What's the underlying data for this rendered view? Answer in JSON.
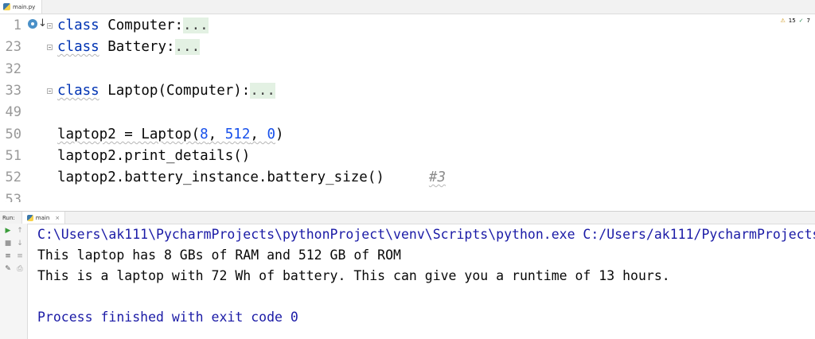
{
  "editor_tab": {
    "file_name": "main.py"
  },
  "inspections": {
    "warnings": "15",
    "checks": "7"
  },
  "gutter": {
    "line_numbers": [
      "1",
      "23",
      "32",
      "33",
      "49",
      "50",
      "51",
      "52",
      "53"
    ]
  },
  "code": {
    "lines": [
      {
        "kw": "class",
        "rest": " Computer:",
        "fold": "..."
      },
      {
        "kw": "class",
        "rest": " Battery:",
        "fold": "..."
      },
      {
        "kw": "class",
        "rest": " Laptop(Computer):",
        "fold": "..."
      }
    ],
    "call_line": {
      "prefix": "laptop2 = Laptop(",
      "arg1": "8",
      "sep1": ", ",
      "arg2": "512",
      "sep2": ", ",
      "arg3": "0",
      "suffix": ")"
    },
    "print_details": "laptop2.print_details()",
    "battery_size": "laptop2.battery_instance.battery_size()",
    "comment": "#3"
  },
  "run_panel": {
    "label": "Run:",
    "tab_name": "main",
    "close": "×"
  },
  "console": {
    "command": "C:\\Users\\ak111\\PycharmProjects\\pythonProject\\venv\\Scripts\\python.exe C:/Users/ak111/PycharmProjects",
    "line1": "This laptop has 8 GBs of RAM and 512 GB of ROM",
    "line2": "This is a laptop with 72 Wh of battery. This can give you a runtime of 13 hours.",
    "exit": "Process finished with exit code 0"
  }
}
